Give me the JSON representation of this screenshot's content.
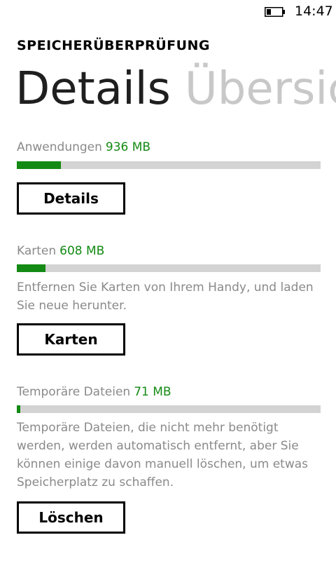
{
  "status_bar": {
    "time": "14:47",
    "battery_icon": "battery-low-icon"
  },
  "app_title": "SPEICHERÜBERPRÜFUNG",
  "pivot": {
    "active": "Details",
    "inactive": "Übersic"
  },
  "sections": [
    {
      "label": "Anwendungen",
      "value": "936 MB",
      "usage_fraction": 0.145,
      "button_label": "Details"
    },
    {
      "label": "Karten",
      "value": "608 MB",
      "usage_fraction": 0.095,
      "description": "Entfernen Sie Karten von Ihrem Handy, und laden Sie neue herunter.",
      "button_label": "Karten"
    },
    {
      "label": "Temporäre Dateien",
      "value": "71 MB",
      "usage_fraction": 0.012,
      "description": "Temporäre Dateien, die nicht mehr benötigt werden, werden automatisch entfernt, aber Sie können einige davon manuell löschen, um etwas Speicherplatz zu schaffen.",
      "button_label": "Löschen"
    }
  ],
  "colors": {
    "accent": "#138a13",
    "track": "#d3d3d3",
    "subtle_text": "#8a8a8a"
  }
}
